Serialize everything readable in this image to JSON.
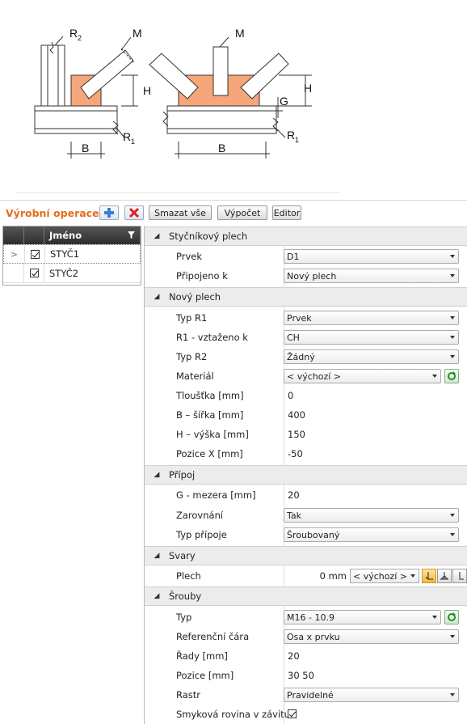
{
  "diagram": {
    "labels": {
      "r2": "R",
      "r2_sub": "2",
      "m_left": "M",
      "m_right": "M",
      "h_left": "H",
      "h_right": "H",
      "g": "G",
      "r1_left": "R",
      "r1_left_sub": "1",
      "r1_right": "R",
      "r1_right_sub": "1",
      "b_left": "B",
      "b_right": "B"
    }
  },
  "toolbar": {
    "title": "Výrobní operace",
    "add_icon": "plus-icon",
    "delete_icon": "delete-icon",
    "delete_all_label": "Smazat vše",
    "compute_label": "Výpočet",
    "editor_label": "Editor"
  },
  "grid": {
    "column_name": "Jméno",
    "rows": [
      {
        "name": "STYČ1",
        "checked": true,
        "current": true
      },
      {
        "name": "STYČ2",
        "checked": true,
        "current": false
      }
    ]
  },
  "props": {
    "sec1": {
      "title": "Styčníkový plech",
      "prvek_label": "Prvek",
      "prvek_value": "D1",
      "pripojeno_label": "Připojeno k",
      "pripojeno_value": "Nový plech"
    },
    "sec2": {
      "title": "Nový plech",
      "typ_r1_label": "Typ R1",
      "typ_r1_value": "Prvek",
      "r1_vztazeno_label": "R1 - vztaženo k",
      "r1_vztazeno_value": "CH",
      "typ_r2_label": "Typ R2",
      "typ_r2_value": "Žádný",
      "material_label": "Materiál",
      "material_value": "< výchozí >",
      "tloustka_label": "Tloušťka [mm]",
      "tloustka_value": "0",
      "sirka_label": "B – šířka [mm]",
      "sirka_value": "400",
      "vyska_label": "H – výška [mm]",
      "vyska_value": "150",
      "pozice_x_label": "Pozice X [mm]",
      "pozice_x_value": "-50"
    },
    "sec3": {
      "title": "Přípoj",
      "mezera_label": "G - mezera [mm]",
      "mezera_value": "20",
      "zarovnani_label": "Zarovnání",
      "zarovnani_value": "Tak",
      "typ_pripoje_label": "Typ přípoje",
      "typ_pripoje_value": "Šroubovaný"
    },
    "sec4": {
      "title": "Svary",
      "plech_label": "Plech",
      "plech_value": "0 mm",
      "plech_select": "< výchozí >"
    },
    "sec5": {
      "title": "Šrouby",
      "typ_label": "Typ",
      "typ_value": "M16 - 10.9",
      "ref_label": "Referenční čára",
      "ref_value": "Osa x prvku",
      "rady_label": "Řady [mm]",
      "rady_value": "20",
      "pozice_label": "Pozice [mm]",
      "pozice_value": "30 50",
      "rastr_label": "Rastr",
      "rastr_value": "Pravidelné",
      "smykova_label": "Smyková rovina v závitu",
      "smykova_checked": true
    }
  }
}
